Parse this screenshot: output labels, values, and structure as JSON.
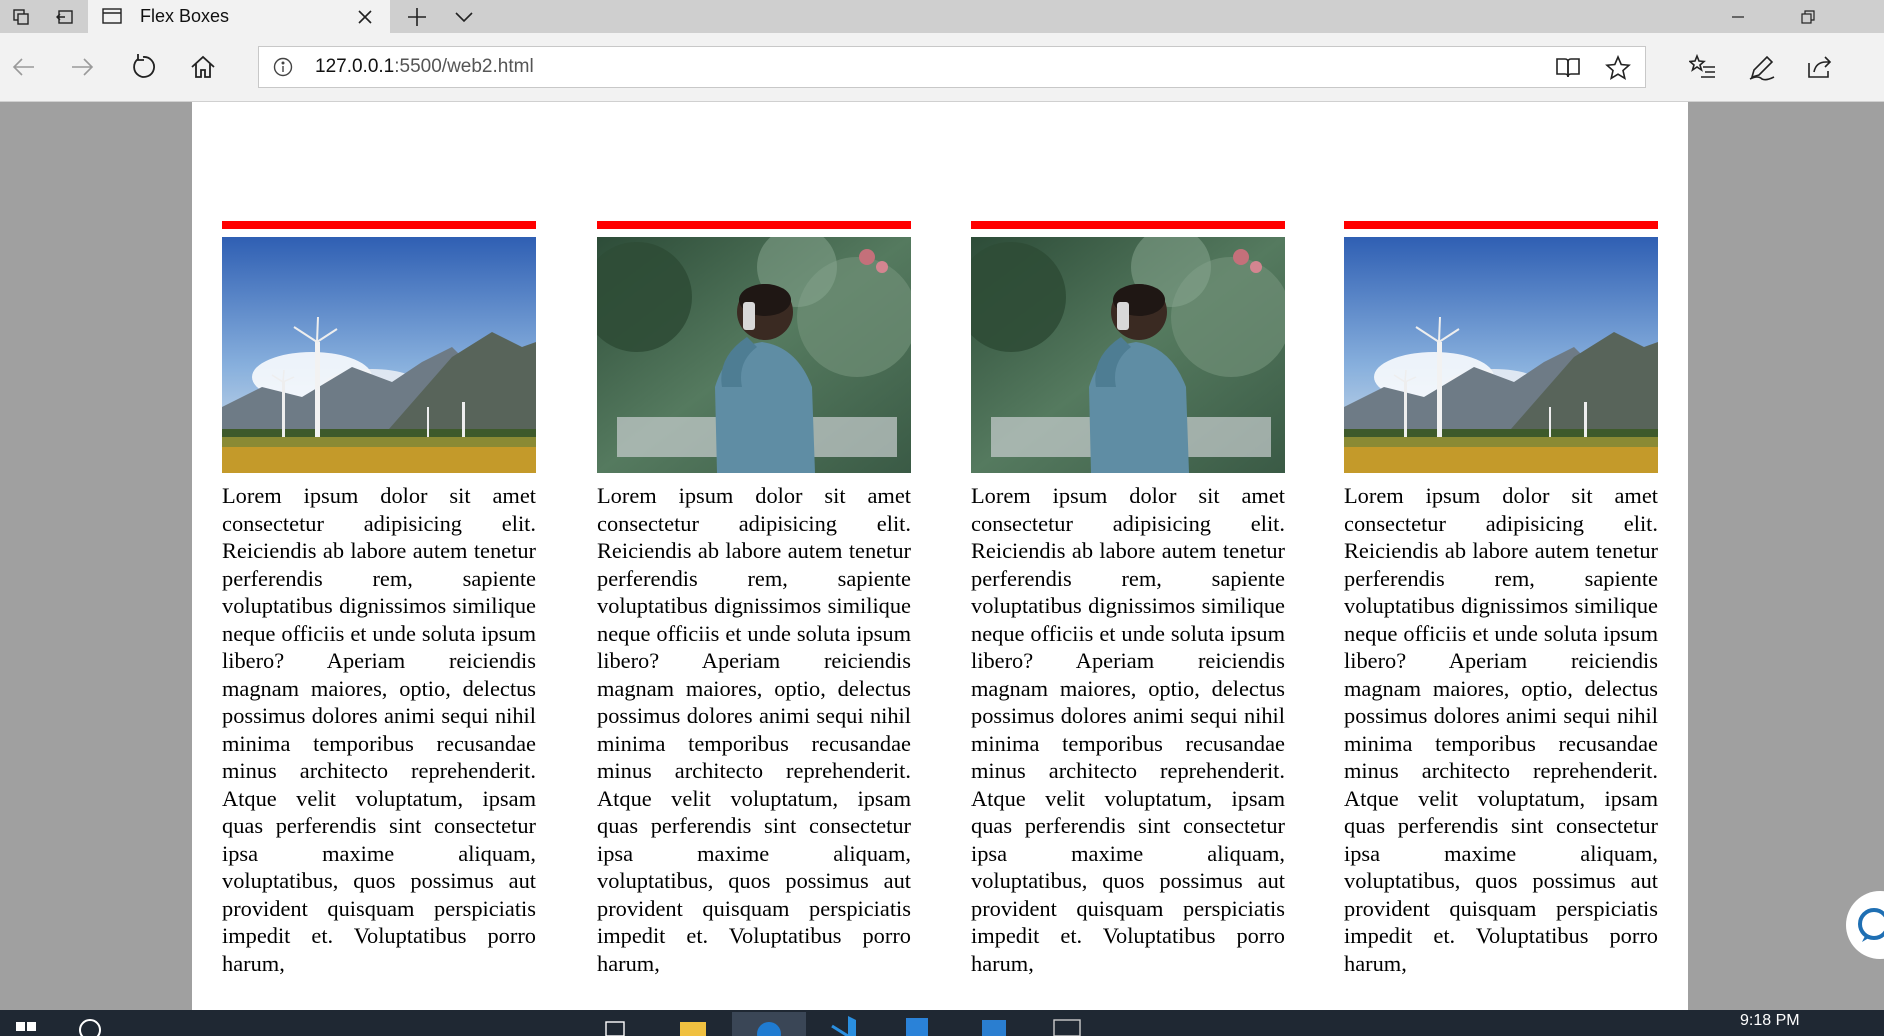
{
  "browser": {
    "tab_title": "Flex Boxes",
    "url_host": "127.0.0.1",
    "url_rest": ":5500/web2.html"
  },
  "icons": {
    "tab_actions": "tab-actions-icon",
    "set_aside": "set-aside-tabs-icon",
    "favicon": "page-icon",
    "close_tab": "close-icon",
    "new_tab": "plus-icon",
    "tab_menu": "chevron-down-icon",
    "minimize": "minimize-icon",
    "maximize": "restore-icon",
    "back": "back-arrow-icon",
    "forward": "forward-arrow-icon",
    "refresh": "refresh-icon",
    "home": "home-icon",
    "site_info": "info-icon",
    "reading_view": "reading-view-icon",
    "favorite": "star-icon",
    "favorites_hub": "favorites-list-icon",
    "notes": "pen-icon",
    "share": "share-icon"
  },
  "cards": [
    {
      "image": "wind-turbines-mountains",
      "text": "Lorem ipsum dolor sit amet consectetur adipisicing elit. Reiciendis ab labore autem tenetur perferendis rem, sapiente voluptatibus dignissimos similique neque officiis et unde soluta ipsum libero? Aperiam reiciendis magnam maiores, optio, delectus possimus dolores animi sequi nihil minima temporibus recusandae minus architecto reprehenderit. Atque velit voluptatum, ipsam quas perferendis sint consectetur ipsa maxime aliquam, voluptatibus, quos possimus aut provident quisquam perspiciatis impedit et. Voluptatibus porro harum,"
    },
    {
      "image": "man-on-phone-garden",
      "text": "Lorem ipsum dolor sit amet consectetur adipisicing elit. Reiciendis ab labore autem tenetur perferendis rem, sapiente voluptatibus dignissimos similique neque officiis et unde soluta ipsum libero? Aperiam reiciendis magnam maiores, optio, delectus possimus dolores animi sequi nihil minima temporibus recusandae minus architecto reprehenderit. Atque velit voluptatum, ipsam quas perferendis sint consectetur ipsa maxime aliquam, voluptatibus, quos possimus aut provident quisquam perspiciatis impedit et. Voluptatibus porro harum,"
    },
    {
      "image": "man-on-phone-garden",
      "text": "Lorem ipsum dolor sit amet consectetur adipisicing elit. Reiciendis ab labore autem tenetur perferendis rem, sapiente voluptatibus dignissimos similique neque officiis et unde soluta ipsum libero? Aperiam reiciendis magnam maiores, optio, delectus possimus dolores animi sequi nihil minima temporibus recusandae minus architecto reprehenderit. Atque velit voluptatum, ipsam quas perferendis sint consectetur ipsa maxime aliquam, voluptatibus, quos possimus aut provident quisquam perspiciatis impedit et. Voluptatibus porro harum,"
    },
    {
      "image": "wind-turbines-mountains",
      "text": "Lorem ipsum dolor sit amet consectetur adipisicing elit. Reiciendis ab labore autem tenetur perferendis rem, sapiente voluptatibus dignissimos similique neque officiis et unde soluta ipsum libero? Aperiam reiciendis magnam maiores, optio, delectus possimus dolores animi sequi nihil minima temporibus recusandae minus architecto reprehenderit. Atque velit voluptatum, ipsam quas perferendis sint consectetur ipsa maxime aliquam, voluptatibus, quos possimus aut provident quisquam perspiciatis impedit et. Voluptatibus porro harum,"
    }
  ],
  "colors": {
    "card_accent": "#ff0000"
  },
  "taskbar": {
    "clock": "9:18 PM"
  }
}
